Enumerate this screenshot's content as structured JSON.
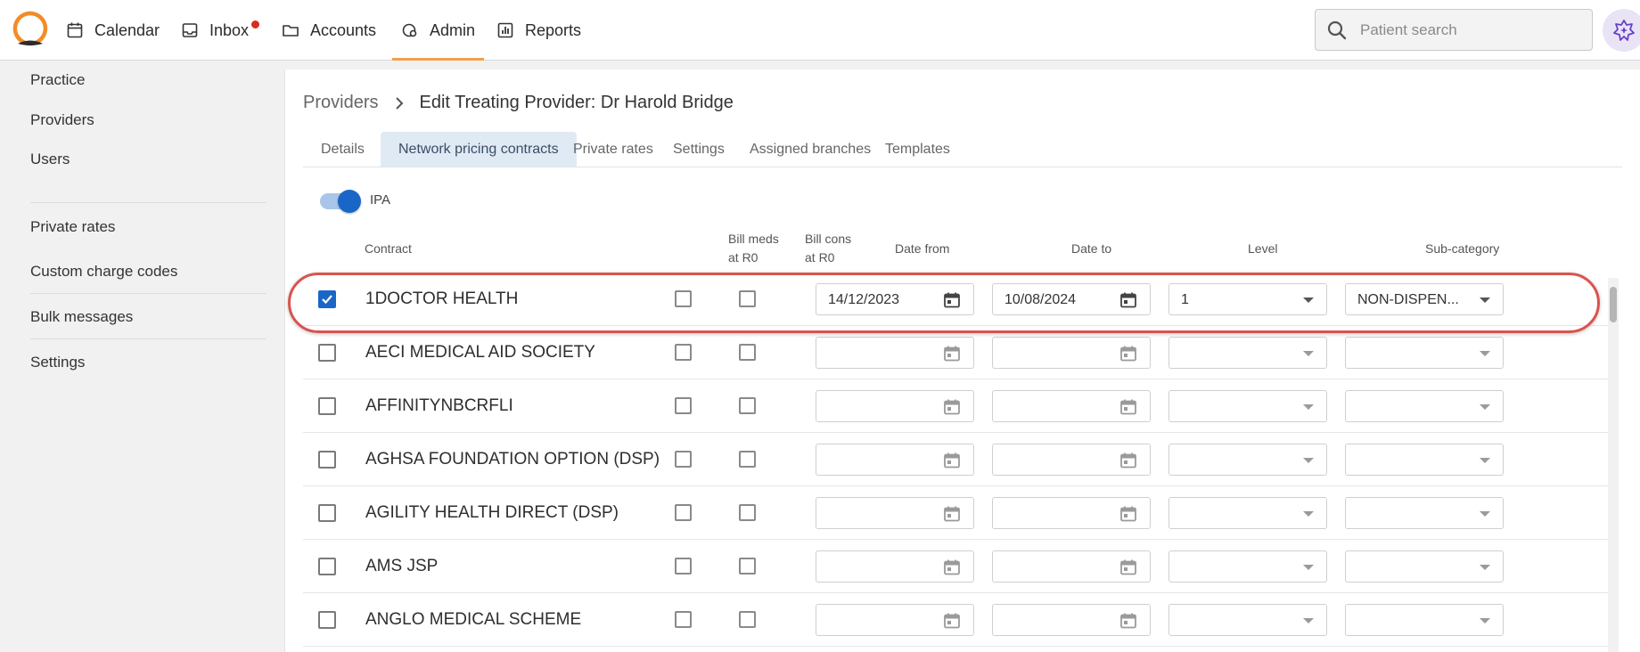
{
  "nav": {
    "items": [
      {
        "label": "Calendar",
        "icon": "calendar-icon"
      },
      {
        "label": "Inbox",
        "icon": "inbox-icon",
        "has_badge": true
      },
      {
        "label": "Accounts",
        "icon": "folder-icon"
      },
      {
        "label": "Admin",
        "icon": "admin-gear-icon",
        "active": true
      },
      {
        "label": "Reports",
        "icon": "reports-icon"
      }
    ],
    "search_placeholder": "Patient search",
    "accent_color": "#f0a04b",
    "badge_color": "#d62d20"
  },
  "sidebar": {
    "items": [
      {
        "label": "Practice"
      },
      {
        "label": "Providers"
      },
      {
        "label": "Users"
      },
      {
        "label": "Private rates"
      },
      {
        "label": "Custom charge codes"
      },
      {
        "label": "Bulk messages"
      },
      {
        "label": "Settings"
      }
    ]
  },
  "breadcrumb": {
    "parent": "Providers",
    "current": "Edit Treating Provider: Dr Harold Bridge"
  },
  "tabs": [
    {
      "label": "Details"
    },
    {
      "label": "Network pricing contracts",
      "active": true
    },
    {
      "label": "Private rates"
    },
    {
      "label": "Settings"
    },
    {
      "label": "Assigned branches"
    },
    {
      "label": "Templates"
    }
  ],
  "ipa_toggle": {
    "label": "IPA",
    "on": true
  },
  "table": {
    "headers": {
      "contract": "Contract",
      "bill_meds_1": "Bill meds",
      "bill_meds_2": "at R0",
      "bill_cons_1": "Bill cons",
      "bill_cons_2": "at R0",
      "date_from": "Date from",
      "date_to": "Date to",
      "level": "Level",
      "sub_category": "Sub-category"
    },
    "rows": [
      {
        "name": "1DOCTOR HEALTH",
        "selected": true,
        "date_from": "14/12/2023",
        "date_to": "10/08/2024",
        "level": "1",
        "sub_category": "NON-DISPEN..."
      },
      {
        "name": "AECI MEDICAL AID SOCIETY",
        "selected": false,
        "date_from": "",
        "date_to": "",
        "level": "",
        "sub_category": ""
      },
      {
        "name": "AFFINITYNBCRFLI",
        "selected": false,
        "date_from": "",
        "date_to": "",
        "level": "",
        "sub_category": ""
      },
      {
        "name": "AGHSA FOUNDATION OPTION (DSP)",
        "selected": false,
        "date_from": "",
        "date_to": "",
        "level": "",
        "sub_category": ""
      },
      {
        "name": "AGILITY HEALTH DIRECT (DSP)",
        "selected": false,
        "date_from": "",
        "date_to": "",
        "level": "",
        "sub_category": ""
      },
      {
        "name": "AMS JSP",
        "selected": false,
        "date_from": "",
        "date_to": "",
        "level": "",
        "sub_category": ""
      },
      {
        "name": "ANGLO MEDICAL SCHEME",
        "selected": false,
        "date_from": "",
        "date_to": "",
        "level": "",
        "sub_category": ""
      }
    ]
  }
}
